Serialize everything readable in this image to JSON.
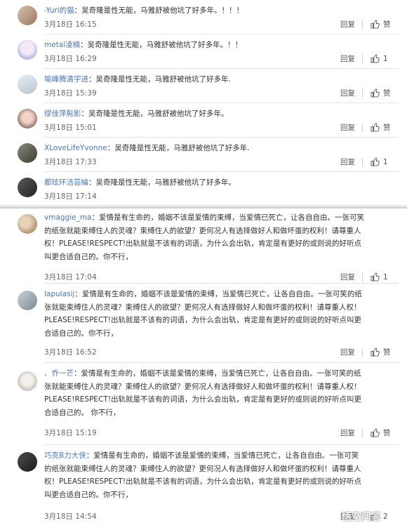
{
  "common": {
    "reply_label": "回复",
    "separator": "：",
    "date_prefix": "3月18日"
  },
  "top_comments": [
    {
      "user": "-Yuri的猫",
      "text": "吴奇隆是性无能，马雅舒被他坑了好多年。！！！",
      "time": "3月18日 16:15",
      "like": "赞"
    },
    {
      "user": "metal凌楠",
      "text": "吴奇隆是性无能，马雅舒被他坑了好多年。！！",
      "time": "3月18日 16:29",
      "like": "1"
    },
    {
      "user": "喻峰腾清宇进",
      "text": "吴奇隆是性无能，马雅舒被他坑了好多年.",
      "time": "3月18日 15:39",
      "like": "赞"
    },
    {
      "user": "缪佳萍髡影",
      "text": "吴奇隆是性无能，马雅舒被他坑了好多年。",
      "time": "3月18日 15:01",
      "like": "赞"
    },
    {
      "user": "XLoveLifeYvonne",
      "text": "吴奇隆是性无能，马雅舒被他坑了好多年.",
      "time": "3月18日 17:33",
      "like": "1"
    },
    {
      "user": "都玹环洁芸綸",
      "text": "吴奇隆是性无能，马雅舒被他坑了好多年。",
      "time": "3月18日 17:14",
      "like": ""
    }
  ],
  "bottom_comments": [
    {
      "user": "vmaggie_ma",
      "lines": [
        "爱情是有生命的，婚姻不该是爱情的束缚，当爱情已死亡，让各自自由。一张可笑",
        "的纸张就能束缚住人的灵魂？束缚住人的欲望？更何况人有选择做好人和做坏蛋的权利！请尊重人",
        "权！PLEASE!RESPECT!出轨就是不该有的词语，为什么会出轨，肯定是有更好的或则说的好听点",
        "叫更合适自己的。你不行，"
      ],
      "time": "3月18日 17:04",
      "like": "1"
    },
    {
      "user": "lapulasij",
      "lines": [
        "爱情是有生命的，婚姻不该是爱情的束缚，当爱情已死亡，让各自自由。一张可笑的纸",
        "张就能束缚住人的灵魂？束缚住人的欲望？更何况人有选择做好人和做坏蛋的权利！请尊重人权！",
        "PLEASE!RESPECT!出轨就是不该有的词语，为什么会出轨，肯定是有更好的或则说的好听点叫更",
        "合适自己的。你不行，"
      ],
      "time": "3月18日 16:52",
      "like": "赞"
    },
    {
      "user": "、乔一芒",
      "lines": [
        "爱情是有生命的，婚姻不该是爱情的束缚，当爱情已死亡，让各自自由。一张可笑的纸",
        "张就能束缚住人的灵魂？束缚住人的欲望？更何况人有选择做好人和做坏蛋的权利！请尊重人权！",
        "PLEASE!RESPECT!出轨就是不该有的词语，为什么会出轨，肯定是有更好的或则说的好听点叫更",
        "合适自己的。 你不行，"
      ],
      "time": "3月18日 15:19",
      "like": "赞"
    },
    {
      "user": "巧克B力大侠",
      "lines": [
        "爱情是有生命的，婚姻不该是爱情的束缚，当爱情已死亡，让各自自由。一张可笑",
        "的纸张就能束缚住人的灵魂？束缚住人的欲望？更何况人有选择做好人和做坏蛋的权利！请尊重人",
        "权！PLEASE!RESPECT!出轨就是不该有的词语，为什么会出轨，肯定是有更好的或则说的好听点",
        "叫更合适自己的。你不行，"
      ],
      "time": "3月18日 14:54",
      "like": "2"
    }
  ],
  "watermark": {
    "text": "悟空问答"
  },
  "colors": {
    "username": "#4a76b8",
    "text": "#333333",
    "meta": "#666666",
    "separator": "#e6e6e6"
  },
  "icons": {
    "like": "thumbs-up-icon",
    "watermark": "wukong-logo-icon"
  }
}
